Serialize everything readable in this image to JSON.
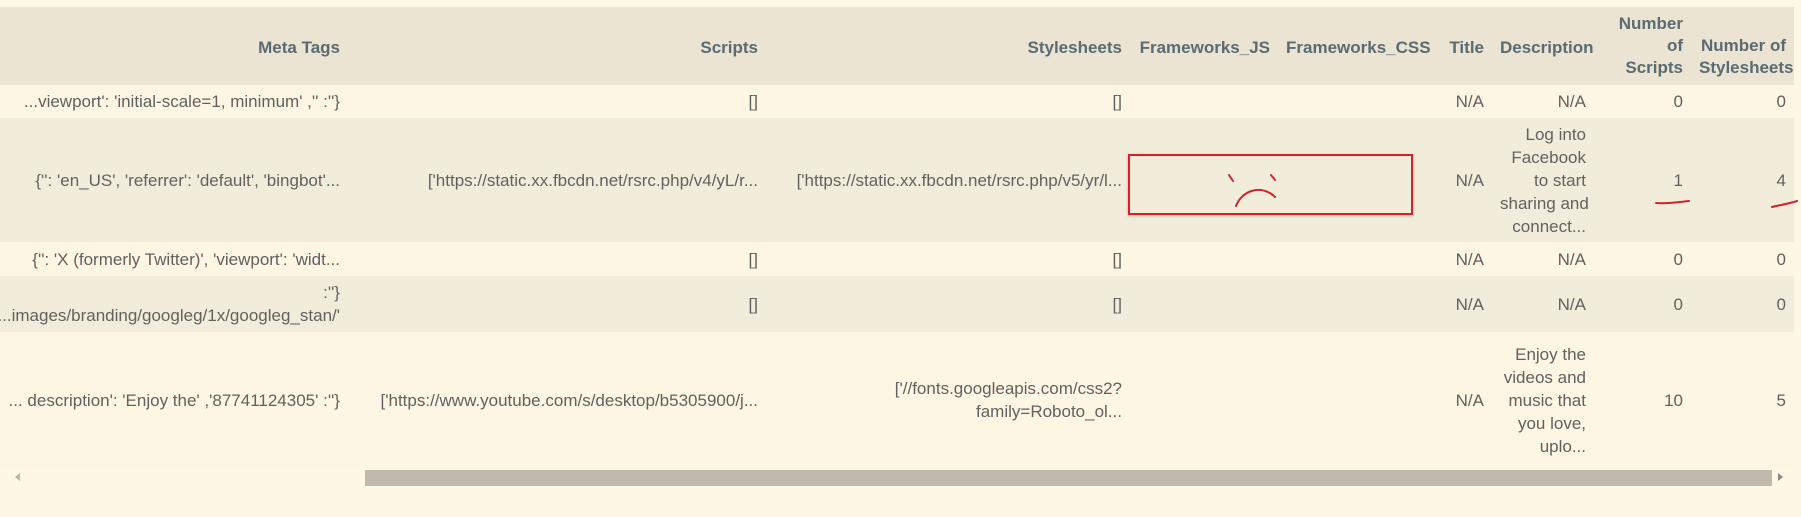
{
  "columns": [
    "Meta Tags",
    "Scripts",
    "Stylesheets",
    "Frameworks_JS",
    "Frameworks_CSS",
    "Title",
    "Description",
    [
      "Number",
      "of",
      "Scripts"
    ],
    [
      "Number of",
      "Stylesheets"
    ]
  ],
  "rows": [
    {
      "meta_tags": "{'': '', 'viewport': 'initial-scale=1, minimum...",
      "scripts": "[]",
      "stylesheets": "[]",
      "frameworks_js": "",
      "frameworks_css": "",
      "title": "N/A",
      "description": [
        "N/A"
      ],
      "num_scripts": "0",
      "num_stylesheets": "0"
    },
    {
      "meta_tags": "{'': 'en_US', 'referrer': 'default', 'bingbot'...",
      "scripts": "['https://static.xx.fbcdn.net/rsrc.php/v4/yL/r...",
      "stylesheets": "['https://static.xx.fbcdn.net/rsrc.php/v5/yr/l...",
      "frameworks_js": "",
      "frameworks_css": "",
      "title": "N/A",
      "description": [
        "Log into",
        "Facebook",
        "to start",
        "sharing and",
        "connect..."
      ],
      "num_scripts": "1",
      "num_stylesheets": "4"
    },
    {
      "meta_tags": "{'': 'X (formerly Twitter)', 'viewport': 'widt...",
      "scripts": "[]",
      "stylesheets": "[]",
      "frameworks_js": "",
      "frameworks_css": "",
      "title": "N/A",
      "description": [
        "N/A"
      ],
      "num_scripts": "0",
      "num_stylesheets": "0"
    },
    {
      "meta_tags": [
        "{'':",
        "'/images/branding/googleg/1x/googleg_stan..."
      ],
      "scripts": "[]",
      "stylesheets": "[]",
      "frameworks_js": "",
      "frameworks_css": "",
      "title": "N/A",
      "description": [
        "N/A"
      ],
      "num_scripts": "0",
      "num_stylesheets": "0"
    },
    {
      "meta_tags": "{'': '87741124305', 'description': 'Enjoy the ...",
      "scripts": "['https://www.youtube.com/s/desktop/b5305900/j...",
      "stylesheets": [
        "['//fonts.googleapis.com/css2?",
        "family=Roboto_ol..."
      ],
      "frameworks_js": "",
      "frameworks_css": "",
      "title": "N/A",
      "description": [
        "Enjoy the",
        "videos and",
        "music that",
        "you love,",
        "uplo..."
      ],
      "num_scripts": "10",
      "num_stylesheets": "5"
    }
  ],
  "colors": {
    "annotation_red": "#d2232a",
    "header_bg": "#ebe4d2",
    "row_even_bg": "#fcf6e3",
    "row_odd_bg": "#f2eddb"
  },
  "icons": {
    "frown": "sad-face-sketch-icon",
    "underline": "red-underline-mark-icon"
  }
}
